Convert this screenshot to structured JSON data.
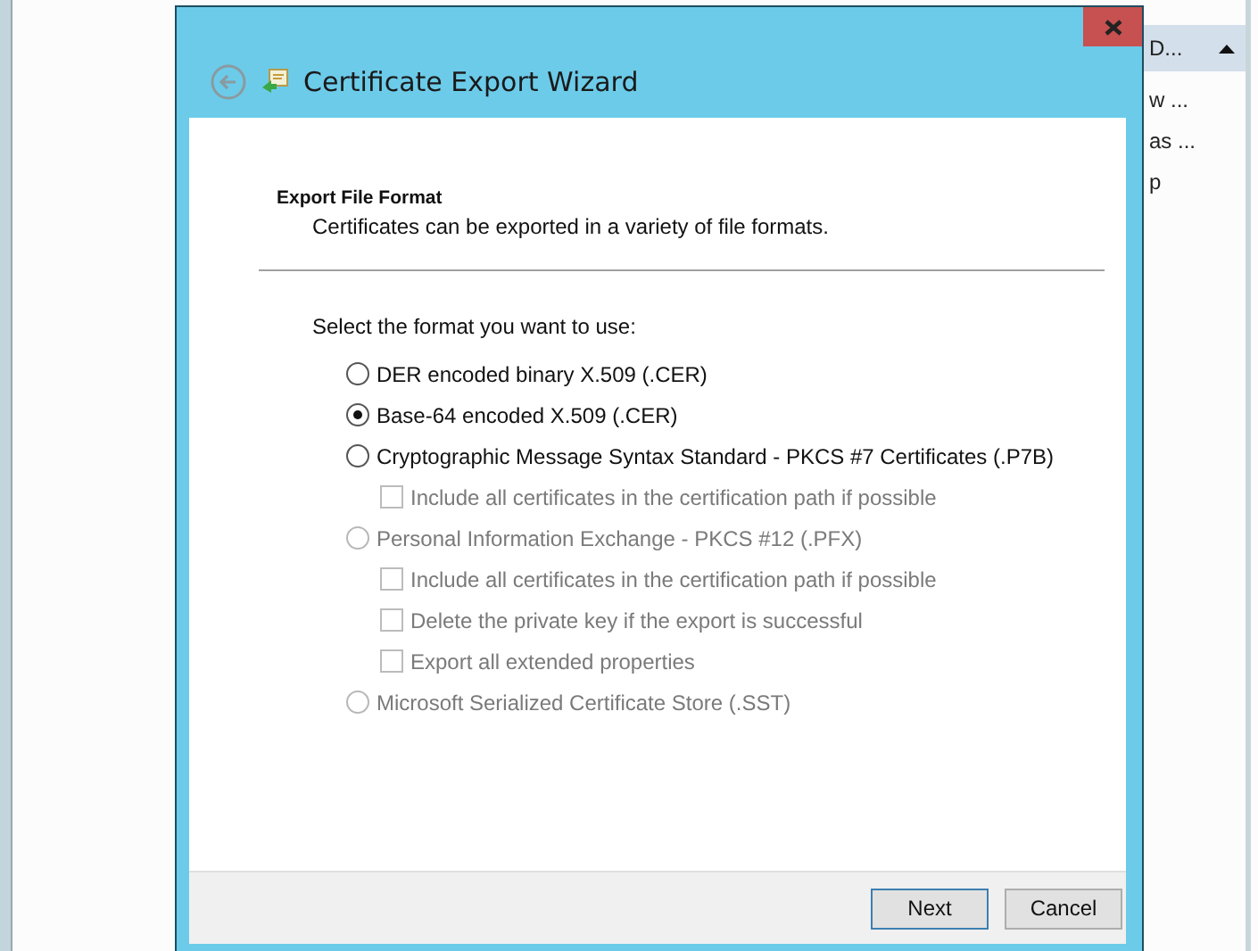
{
  "background_window": {
    "menu_items": [
      {
        "label": "D...",
        "selected": true
      },
      {
        "label": "w ...",
        "selected": false
      },
      {
        "label": "as ...",
        "selected": false
      },
      {
        "label": "p",
        "selected": false
      }
    ]
  },
  "dialog": {
    "title": "Certificate Export Wizard",
    "header": {
      "title": "Export File Format",
      "subtitle": "Certificates can be exported in a variety of file formats."
    },
    "prompt": "Select the format you want to use:",
    "formats": [
      {
        "label": "DER encoded binary X.509 (.CER)",
        "selected": false,
        "disabled": false
      },
      {
        "label": "Base-64 encoded X.509 (.CER)",
        "selected": true,
        "disabled": false
      },
      {
        "label": "Cryptographic Message Syntax Standard - PKCS #7 Certificates (.P7B)",
        "selected": false,
        "disabled": false,
        "options": [
          {
            "label": "Include all certificates in the certification path if possible",
            "checked": false,
            "disabled": true
          }
        ]
      },
      {
        "label": "Personal Information Exchange - PKCS #12 (.PFX)",
        "selected": false,
        "disabled": true,
        "options": [
          {
            "label": "Include all certificates in the certification path if possible",
            "checked": false,
            "disabled": true
          },
          {
            "label": "Delete the private key if the export is successful",
            "checked": false,
            "disabled": true
          },
          {
            "label": "Export all extended properties",
            "checked": false,
            "disabled": true
          }
        ]
      },
      {
        "label": "Microsoft Serialized Certificate Store (.SST)",
        "selected": false,
        "disabled": true
      }
    ],
    "buttons": [
      {
        "label": "Next",
        "default": true
      },
      {
        "label": "Cancel",
        "default": false
      }
    ]
  }
}
